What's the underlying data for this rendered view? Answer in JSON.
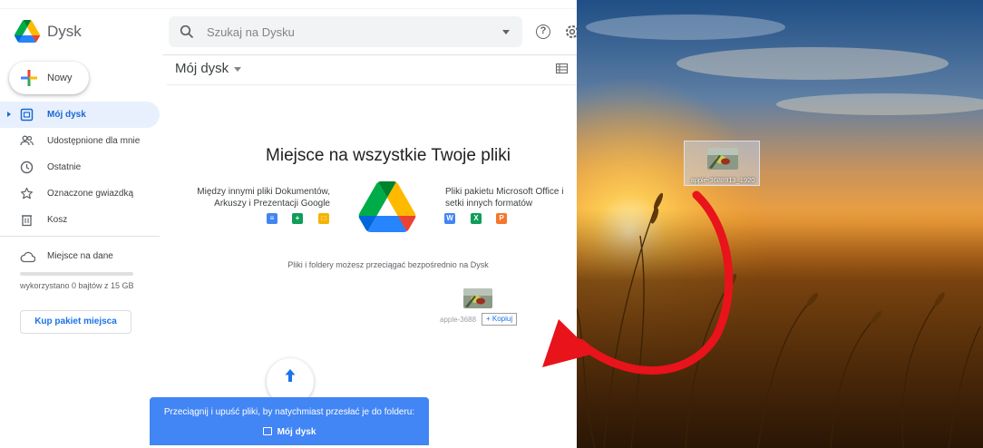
{
  "app": {
    "name": "Dysk"
  },
  "search": {
    "placeholder": "Szukaj na Dysku"
  },
  "header": {
    "folder_title": "Mój dysk"
  },
  "sidebar": {
    "new_button": "Nowy",
    "items": [
      {
        "label": "Mój dysk",
        "icon": "my-drive-icon",
        "active": true
      },
      {
        "label": "Udostępnione dla mnie",
        "icon": "shared-icon"
      },
      {
        "label": "Ostatnie",
        "icon": "clock-icon"
      },
      {
        "label": "Oznaczone gwiazdką",
        "icon": "star-icon"
      },
      {
        "label": "Kosz",
        "icon": "trash-icon"
      }
    ],
    "storage_label": "Miejsce na dane",
    "storage_used": "wykorzystano 0 bajtów z 15 GB",
    "buy_storage": "Kup pakiet miejsca"
  },
  "empty_state": {
    "title": "Miejsce na wszystkie Twoje pliki",
    "left_text": "Między innymi pliki Dokumentów, Arkuszy i Prezentacji Google",
    "right_text": "Pliki pakietu Microsoft Office i setki innych formatów",
    "drop_hint": "Pliki i foldery możesz przeciągać bezpośrednio na Dysk",
    "app_icons_left": [
      "docs-icon",
      "sheets-icon",
      "slides-icon"
    ],
    "app_icons_right": [
      {
        "icon": "word-icon",
        "letter": "W"
      },
      {
        "icon": "excel-icon",
        "letter": "X"
      },
      {
        "icon": "powerpoint-icon",
        "letter": "P"
      }
    ]
  },
  "drag": {
    "file_name_partial": "apple-3688",
    "copy_tooltip": "+ Kopiuj"
  },
  "upload_banner": {
    "line1": "Przeciągnij i upuść pliki, by natychmiast przesłać je do folderu:",
    "line2": "Mój dysk"
  },
  "desktop": {
    "file_name": "apple-3688913_1920"
  },
  "colors": {
    "drive_blue": "#4285f4",
    "active_nav_bg": "#e8f0fe",
    "active_nav_text": "#1967d2",
    "arrow_red": "#e8131b"
  }
}
